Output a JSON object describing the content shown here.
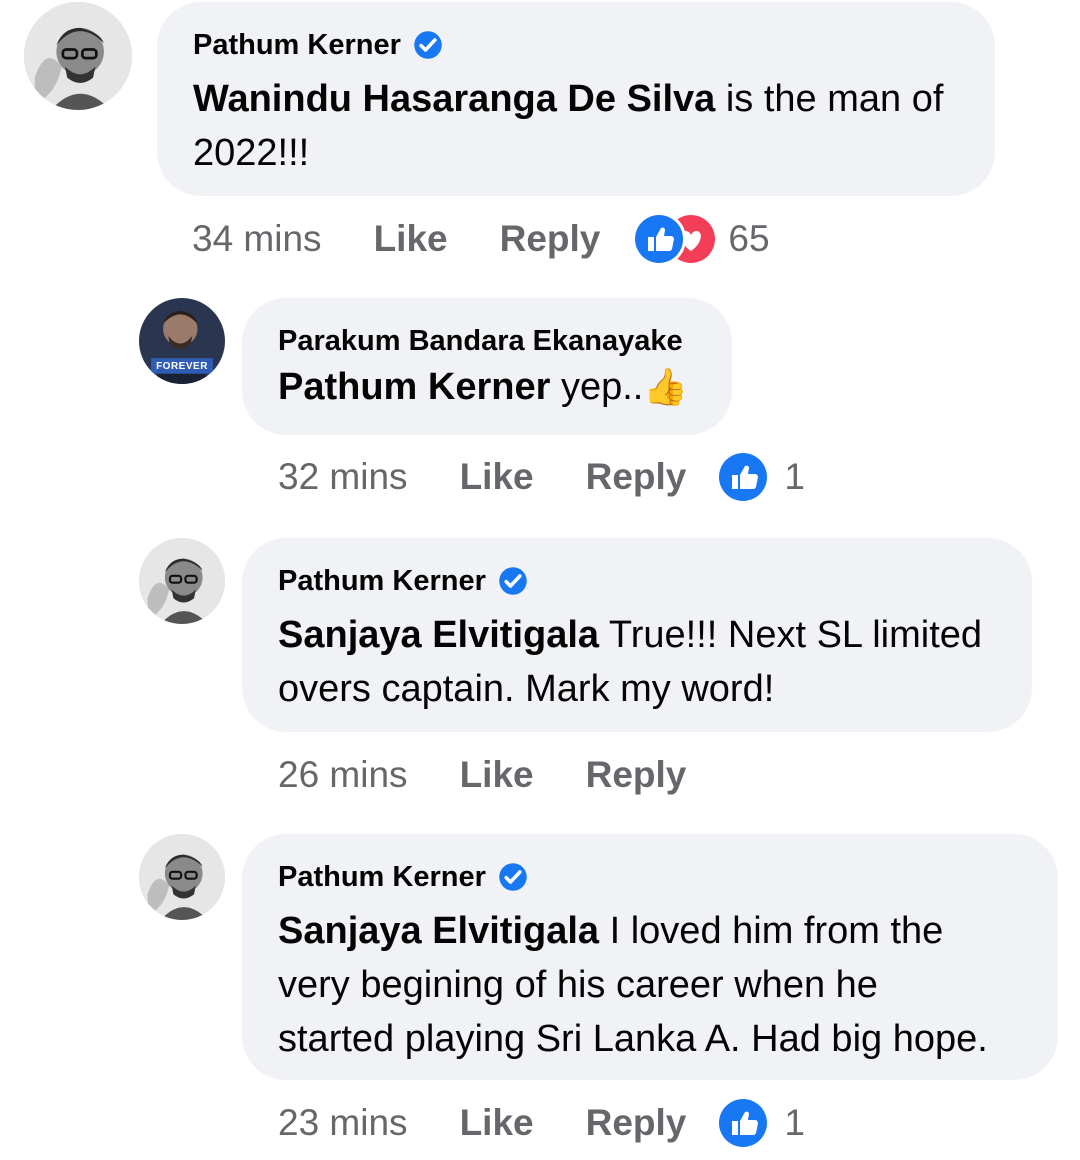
{
  "comments": [
    {
      "author": "Pathum Kerner",
      "verified": true,
      "tag": "Wanindu Hasaranga De Silva",
      "text_line1": " is the man of",
      "text_line2": "2022!!!",
      "time": "34 mins",
      "like": "Like",
      "reply": "Reply",
      "reactions": [
        "like",
        "love"
      ],
      "reaction_count": "65"
    },
    {
      "author": "Parakum Bandara Ekanayake",
      "verified": false,
      "avatar_badge": "FOREVER",
      "tag": "Pathum Kerner",
      "text_line1": " yep..",
      "emoji": "👍",
      "time": "32 mins",
      "like": "Like",
      "reply": "Reply",
      "reactions": [
        "like"
      ],
      "reaction_count": "1"
    },
    {
      "author": "Pathum Kerner",
      "verified": true,
      "tag": "Sanjaya Elvitigala",
      "text_line1": " True!!! Next SL limited",
      "text_line2": "overs captain. Mark my word!",
      "time": "26 mins",
      "like": "Like",
      "reply": "Reply"
    },
    {
      "author": "Pathum Kerner",
      "verified": true,
      "tag": "Sanjaya Elvitigala",
      "text_line1": " I loved him from the",
      "text_line2": "very begining of his career when he",
      "text_line3": "started playing Sri Lanka A. Had big hope.",
      "time": "23 mins",
      "like": "Like",
      "reply": "Reply",
      "reactions": [
        "like"
      ],
      "reaction_count": "1"
    }
  ],
  "colors": {
    "bubble": "#f0f2f5",
    "meta": "#65676b",
    "like_blue": "#1877f2",
    "love_red": "#f33e58",
    "verified_blue": "#1877f2"
  }
}
